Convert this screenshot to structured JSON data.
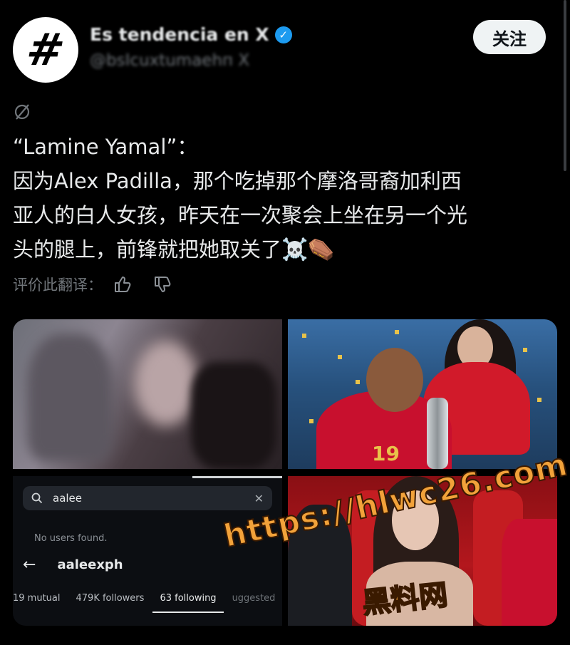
{
  "header": {
    "avatar_symbol": "#",
    "name": "Es tendencia en X",
    "handle": "@bsIcuxtumaehп X",
    "follow_label": "关注"
  },
  "tweet": {
    "lines": [
      "“Lamine Yamal”：",
      "因为Alex Padilla，那个吃掉那个摩洛哥裔加利西",
      "亚人的白人女孩，昨天在一次聚会上坐在另一个光",
      "头的腿上，前锋就把她取关了"
    ],
    "emojis": [
      "☠️",
      "⚰️"
    ],
    "rate_label": "评价此翻译："
  },
  "media": {
    "jersey_number": "19",
    "search": {
      "value": "aalee",
      "no_users": "No users found.",
      "username": "aaleexph",
      "stats": [
        "19 mutual",
        "479K followers",
        "63 following",
        "uggested"
      ]
    }
  },
  "watermark": {
    "url": "https://hlwc26.com",
    "site": "黑料网"
  },
  "colors": {
    "background": "#000000",
    "text": "#e7e9ea",
    "muted": "#71767b",
    "verified": "#1d9bf0",
    "watermark": "#f2a23a"
  }
}
